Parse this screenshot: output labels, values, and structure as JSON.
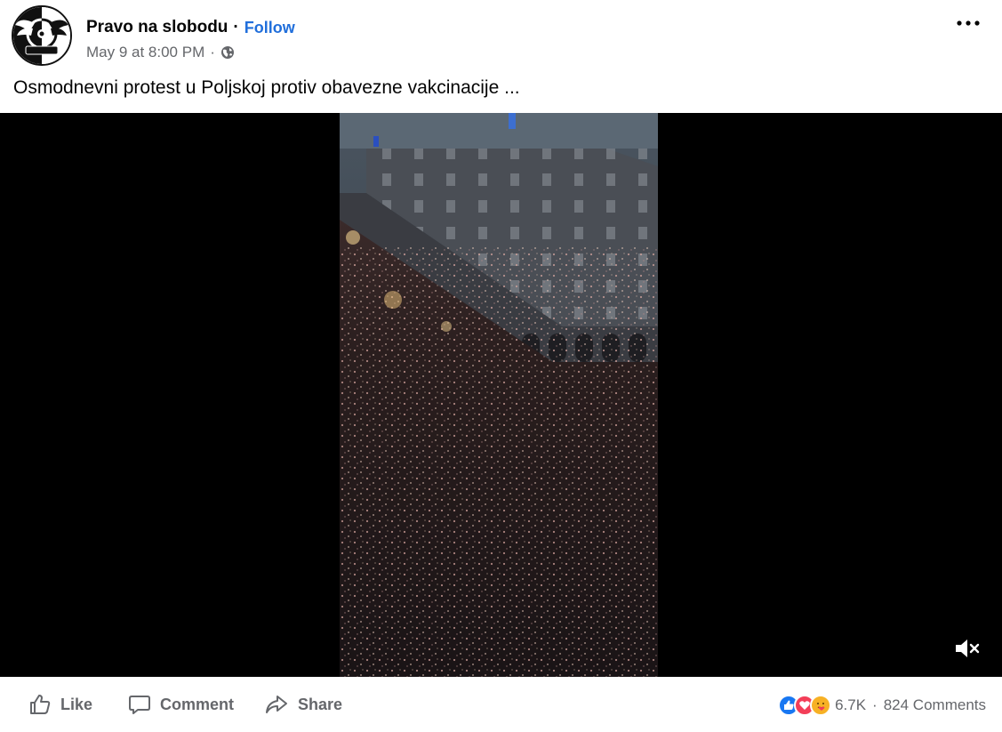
{
  "post": {
    "page_name": "Pravo na slobodu",
    "name_separator": "·",
    "follow_label": "Follow",
    "timestamp": "May 9 at 8:00 PM",
    "meta_separator": "·",
    "privacy_icon": "globe-icon",
    "more_icon": "more-options-icon",
    "caption": "Osmodnevni protest u Poljskoj protiv obavezne vakcinacije ..."
  },
  "video": {
    "mute_icon": "volume-muted-icon",
    "letterbox_color": "#000000"
  },
  "actions": {
    "like_label": "Like",
    "comment_label": "Comment",
    "share_label": "Share"
  },
  "engagement": {
    "reaction_icons": [
      "like-reaction-icon",
      "love-reaction-icon",
      "care-reaction-icon"
    ],
    "reaction_count": "6.7K",
    "separator": "·",
    "comment_count": "824 Comments"
  },
  "colors": {
    "link_blue": "#216fdb",
    "secondary_text": "#65676b",
    "like_blue": "#1877f2",
    "love_red": "#f33e58",
    "care_yellow": "#f7b125"
  }
}
